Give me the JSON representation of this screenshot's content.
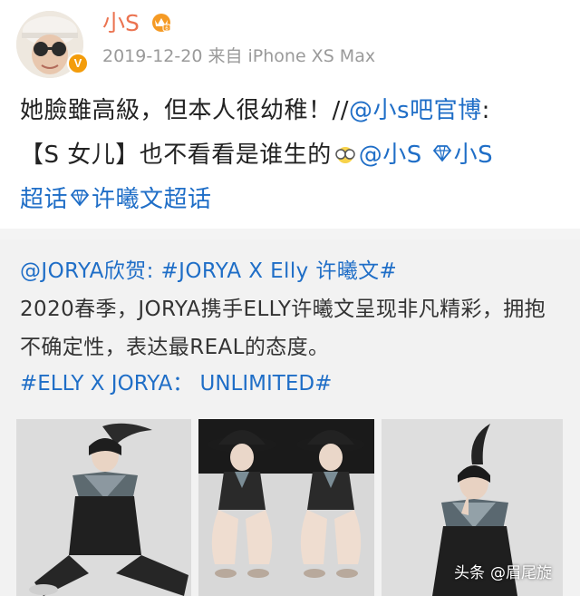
{
  "post": {
    "username": "小S",
    "timestamp": "2019-12-20",
    "source": "来自 iPhone XS Max",
    "text_line1_plain": "她臉雖高級，但本人很幼稚！//",
    "text_line1_mention": "@小s吧官博",
    "text_line1_colon": ":",
    "text_line2_plain": "【S 女儿】也不看看是谁生的",
    "text_line2_mention": "@小S",
    "text_line2_topic": "小S",
    "text_line3_topic1": "超话",
    "text_line3_topic2": "许曦文超话",
    "icons": {
      "avatar": "avatar-photo",
      "verified": "v-badge",
      "vip": "crown-badge",
      "emoji": "glasses-emoji",
      "topic": "diamond-icon"
    },
    "verified_letter": "V"
  },
  "repost": {
    "mention": "@JORYA",
    "mention_suffix": "欣贺: ",
    "hashtag1": "#JORYA X Elly 许曦文#",
    "body": "2020春季，JORYA携手ELLY许曦文呈现非凡精彩，拥抱不确定性，表达最REAL的态度。",
    "hashtag2": "#ELLY X JORYA： UNLIMITED#"
  },
  "photos": [
    "photo-1",
    "photo-2",
    "photo-3"
  ],
  "watermark": {
    "brand": "头条",
    "handle": "@眉尾旋"
  },
  "colors": {
    "accent": "#eb7350",
    "link": "#1f6ec7",
    "meta": "#9a9a9a"
  }
}
